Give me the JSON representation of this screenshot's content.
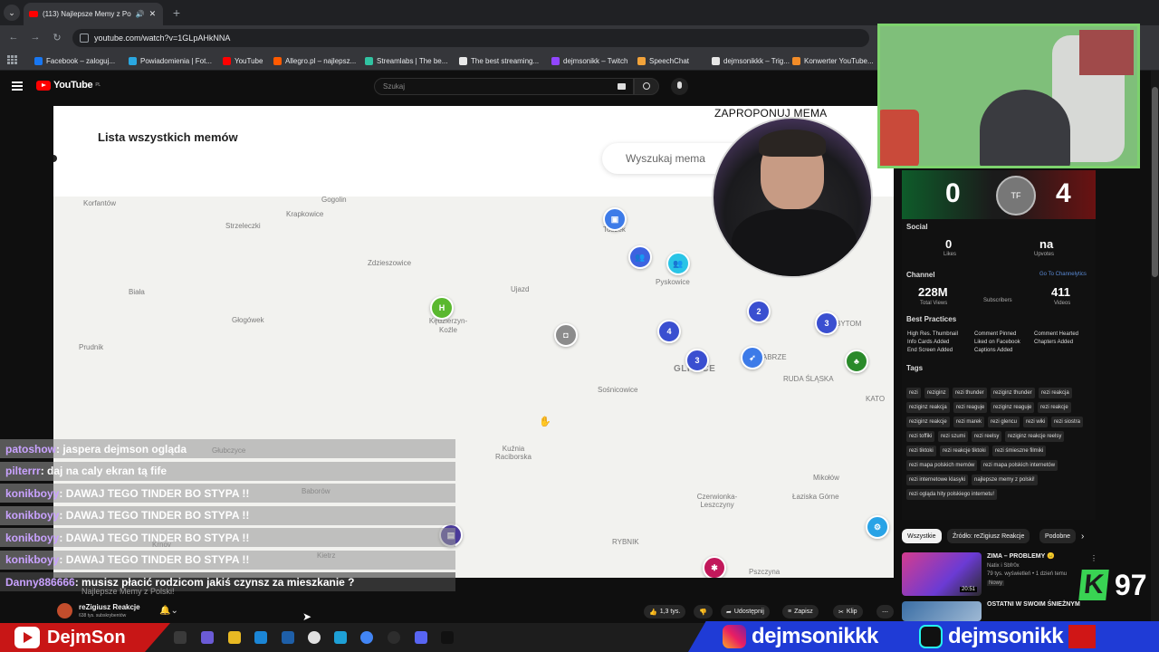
{
  "browser": {
    "tab_title": "(113) Najlepsze Memy z Po",
    "url": "youtube.com/watch?v=1GLpAHkNNA",
    "bookmarks": [
      {
        "label": "Facebook – zaloguj...",
        "color": "#1877f2"
      },
      {
        "label": "Powiadomienia | Fot...",
        "color": "#2aa7e0"
      },
      {
        "label": "YouTube",
        "color": "#ff0000"
      },
      {
        "label": "Allegro.pl – najlepsz...",
        "color": "#ff5a00"
      },
      {
        "label": "Streamlabs | The be...",
        "color": "#31c3a2"
      },
      {
        "label": "The best streaming...",
        "color": "#e8e8e8"
      },
      {
        "label": "dejmsonikk – Twitch",
        "color": "#9146ff"
      },
      {
        "label": "SpeechChat",
        "color": "#f2a33a"
      },
      {
        "label": "dejmsonikkk – Trig...",
        "color": "#e6e6e6"
      },
      {
        "label": "Konwerter YouTube...",
        "color": "#f28c28"
      }
    ]
  },
  "youtube": {
    "logo": "YouTube",
    "logo_country": "PL",
    "search_placeholder": "Szukaj"
  },
  "site": {
    "title": "Lista wszystkich memów",
    "suggest_button": "ZAPROPONUJ MEMA",
    "search_placeholder": "Wyszukaj mema"
  },
  "map": {
    "towns": [
      {
        "name": "Korfantów",
        "big": false
      },
      {
        "name": "Krapkowice",
        "big": false
      },
      {
        "name": "Gogolin",
        "big": false
      },
      {
        "name": "Strzeleczki",
        "big": false
      },
      {
        "name": "Zdzieszowice",
        "big": false
      },
      {
        "name": "Toszek",
        "big": false
      },
      {
        "name": "Biała",
        "big": false
      },
      {
        "name": "Głogówek",
        "big": false
      },
      {
        "name": "Ujazd",
        "big": false
      },
      {
        "name": "Pyskowice",
        "big": false
      },
      {
        "name": "Kędzierzyn-Koźle",
        "big": false
      },
      {
        "name": "Prudnik",
        "big": false
      },
      {
        "name": "GLIWICE",
        "big": true
      },
      {
        "name": "ZABRZE",
        "big": false
      },
      {
        "name": "RUDA ŚLĄSKA",
        "big": false
      },
      {
        "name": "KATO",
        "big": false
      },
      {
        "name": "Sośnicowice",
        "big": false
      },
      {
        "name": "Głubczyce",
        "big": false
      },
      {
        "name": "Kuźnia Raciborska",
        "big": false
      },
      {
        "name": "Baborów",
        "big": false
      },
      {
        "name": "Mikołów",
        "big": false
      },
      {
        "name": "Łaziska Górne",
        "big": false
      },
      {
        "name": "Czerwionka-Leszczyny",
        "big": false
      },
      {
        "name": "RYBNIK",
        "big": false
      },
      {
        "name": "Kietrz",
        "big": false
      },
      {
        "name": "Krnov",
        "big": false
      },
      {
        "name": "BYTOM",
        "big": false
      },
      {
        "name": "Pszczyna",
        "big": false
      }
    ],
    "pins": [
      {
        "label": "",
        "color": "#3d7be8",
        "icon": "chat-icon"
      },
      {
        "label": "",
        "color": "#3d63e0",
        "icon": "people-icon"
      },
      {
        "label": "",
        "color": "#29c4e6",
        "icon": "people-icon"
      },
      {
        "label": "",
        "color": "#5ab82f",
        "icon": "h-icon"
      },
      {
        "label": "",
        "color": "#8c8c8c",
        "icon": "ghost-icon"
      },
      {
        "label": "4",
        "color": "#3a4fd0",
        "icon": ""
      },
      {
        "label": "2",
        "color": "#3a4fd0",
        "icon": ""
      },
      {
        "label": "3",
        "color": "#3a4fd0",
        "icon": ""
      },
      {
        "label": "3",
        "color": "#3a4fd0",
        "icon": ""
      },
      {
        "label": "",
        "color": "#3d7be8",
        "icon": "rocket-icon"
      },
      {
        "label": "",
        "color": "#2a8a2a",
        "icon": "tree-icon"
      },
      {
        "label": "",
        "color": "#4a3a9a",
        "icon": "box-icon"
      },
      {
        "label": "",
        "color": "#c2185b",
        "icon": "star-icon"
      },
      {
        "label": "",
        "color": "#29a3e6",
        "icon": "gear-icon"
      }
    ]
  },
  "chat": [
    {
      "user": "patoshow",
      "msg": ": jaspera dejmson ogląda"
    },
    {
      "user": "pilterrr",
      "msg": ": daj na caly ekran tą fife"
    },
    {
      "user": "konikboyy",
      "msg": ": DAWAJ TEGO TINDER BO STYPA !!"
    },
    {
      "user": "konikboyy",
      "msg": ": DAWAJ TEGO TINDER BO STYPA !!"
    },
    {
      "user": "konikboyy",
      "msg": ": DAWAJ TEGO TINDER BO STYPA !!"
    },
    {
      "user": "konikboyy",
      "msg": ": DAWAJ TEGO TINDER BO STYPA !!"
    },
    {
      "user": "Danny886666",
      "msg": ": musisz płacić rodzicom jakiś czynsz za mieszkanie ?"
    }
  ],
  "score": {
    "left": "0",
    "right": "4",
    "logo": "TF"
  },
  "seo": {
    "section_social": "Social",
    "likes_value": "0",
    "likes_label": "Likes",
    "upvotes_value": "na",
    "upvotes_label": "Upvotes",
    "section_channel": "Channel",
    "channel_link": "Go To Channelytics",
    "views_value": "228M",
    "views_label": "Total Views",
    "subscribers_label": "Subscribers",
    "videos_value": "411",
    "videos_label": "Videos",
    "section_practices": "Best Practices",
    "practices": [
      "High Res. Thumbnail",
      "Comment Pinned",
      "Comment Hearted",
      "Info Cards Added",
      "Liked on Facebook",
      "Chapters Added",
      "End Screen Added",
      "Captions Added"
    ],
    "section_tags": "Tags",
    "tags": [
      "rezi",
      "reziginz",
      "rezi thunder",
      "reziginz thunder",
      "rezi reakcja",
      "reziginz reakcja",
      "rezi reaguje",
      "reziginz reaguje",
      "rezi reakcje",
      "reziginz reakcje",
      "rezi marek",
      "rezi glencu",
      "rezi wiki",
      "rezi siostra",
      "rezi toffiki",
      "rezi szumi",
      "rezi reelsy",
      "reziginz reakcje reelsy",
      "rezi tiktoki",
      "rezi reakcje tiktoki",
      "rezi śmieszne filmiki",
      "rezi mapa polskich memów",
      "rezi mapa polskich internetów",
      "rezi internetowe klasyki",
      "najlepsze memy z polski!",
      "rezi ogląda hity polskiego internetu!"
    ]
  },
  "suggestions": {
    "chips": [
      "Wszystkie",
      "Źródło: reZigiusz Reakcje",
      "Podobne"
    ],
    "items": [
      {
        "title": "ZIMA – PROBLEMY 😑",
        "channel": "Natix i Sbfr0x",
        "meta": "79 tys. wyświetleń • 1 dzień temu",
        "badge": "Nowy",
        "duration": "20:51"
      },
      {
        "title": "OSTATNI W SWOIM ŚNIEŻNYM",
        "channel": "",
        "meta": "",
        "badge": "",
        "duration": ""
      }
    ]
  },
  "video_meta": {
    "channel_name": "reZigiusz Reakcje",
    "channel_subs": "638 tys. subskrybentów",
    "likes": "1,3 tys.",
    "share": "Udostępnij",
    "save": "Zapisz",
    "clip": "Klip",
    "watermark": "Najlepsze Memy z Polski!"
  },
  "overlay": {
    "left_name": "DejmSon",
    "instagram": "dejmsonikkk",
    "tiktok": "dejmsonikk",
    "k_count": "97"
  },
  "colors": {
    "accent_red": "#c81616",
    "accent_blue": "#1f3bd6",
    "cam_border": "#7dd36d",
    "k_green": "#39d353"
  }
}
